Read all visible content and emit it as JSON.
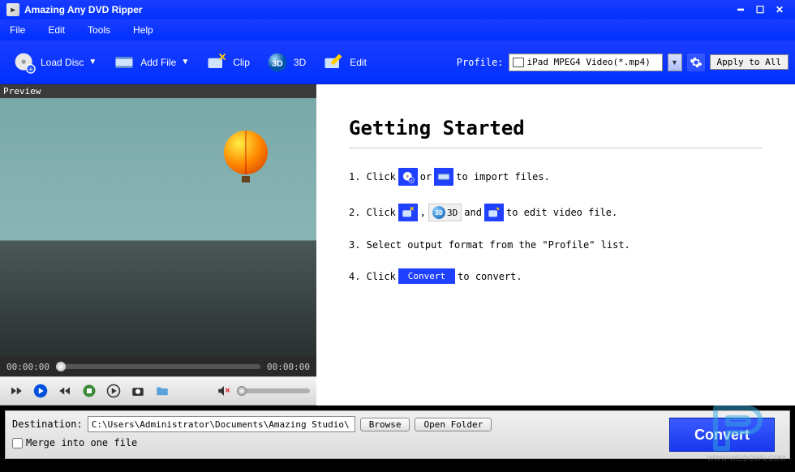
{
  "app": {
    "title": "Amazing Any DVD Ripper"
  },
  "menu": {
    "file": "File",
    "edit": "Edit",
    "tools": "Tools",
    "help": "Help"
  },
  "toolbar": {
    "load_disc": "Load Disc",
    "add_file": "Add File",
    "clip": "Clip",
    "three_d": "3D",
    "edit": "Edit",
    "profile_label": "Profile:",
    "profile_value": "iPad MPEG4 Video(*.mp4)",
    "apply_all": "Apply to All"
  },
  "preview": {
    "label": "Preview",
    "time_start": "00:00:00",
    "time_end": "00:00:00"
  },
  "guide": {
    "title": "Getting Started",
    "s1a": "1. Click",
    "s1b": "or",
    "s1c": "to import files.",
    "s2a": "2. Click",
    "s2b": ",",
    "s2c": "and",
    "s2d": "to edit video file.",
    "s2_3d": "3D",
    "s3": "3. Select output format from the \"Profile\" list.",
    "s4a": "4. Click",
    "s4b": "to convert.",
    "s4_btn": "Convert"
  },
  "bottom": {
    "dest_label": "Destination:",
    "dest_value": "C:\\Users\\Administrator\\Documents\\Amazing Studio\\",
    "browse": "Browse",
    "open_folder": "Open Folder",
    "merge": "Merge into one file",
    "convert": "Convert"
  },
  "watermark": {
    "text": "WWW.WEIDOWN.COM"
  }
}
